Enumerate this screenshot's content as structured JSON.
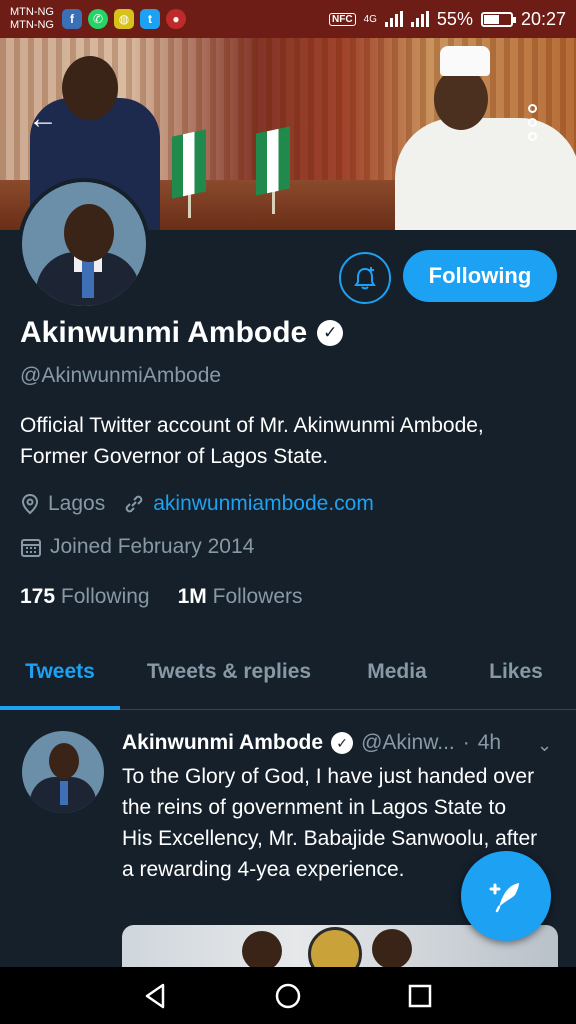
{
  "status_bar": {
    "carrier_1": "MTN-NG",
    "carrier_2": "MTN-NG",
    "network": "4G",
    "nfc": "NFC",
    "battery": "55%",
    "time": "20:27"
  },
  "profile": {
    "name": "Akinwunmi Ambode",
    "handle": "@AkinwunmiAmbode",
    "bio": "Official Twitter account of Mr. Akinwunmi Ambode, Former Governor of Lagos State.",
    "location": "Lagos",
    "website": "akinwunmiambode.com",
    "joined": "Joined February 2014",
    "following_count": "175",
    "following_label": "Following",
    "followers_count": "1M",
    "followers_label": "Followers",
    "follow_button_label": "Following",
    "verified": true
  },
  "tabs": [
    {
      "label": "Tweets",
      "active": true
    },
    {
      "label": "Tweets & replies",
      "active": false
    },
    {
      "label": "Media",
      "active": false
    },
    {
      "label": "Likes",
      "active": false
    }
  ],
  "tweet": {
    "author_name": "Akinwunmi Ambode",
    "author_handle": "@Akinw...",
    "separator": "·",
    "time": "4h",
    "text": "To the Glory of God, I have just handed over the reins of government in Lagos State to His Excellency, Mr. Babajide Sanwoolu, after a rewarding 4-yea experience."
  },
  "icons": {
    "back": "arrow-left-icon",
    "more": "more-vertical-icon",
    "bell": "bell-plus-icon",
    "verified": "verified-badge-icon",
    "location": "location-pin-icon",
    "link": "link-icon",
    "calendar": "calendar-icon",
    "compose": "compose-tweet-icon",
    "chevron": "chevron-down-icon"
  },
  "colors": {
    "accent": "#1da1f2",
    "background": "#15202b",
    "muted": "#8899a6",
    "status_bar": "#6e1d16"
  }
}
